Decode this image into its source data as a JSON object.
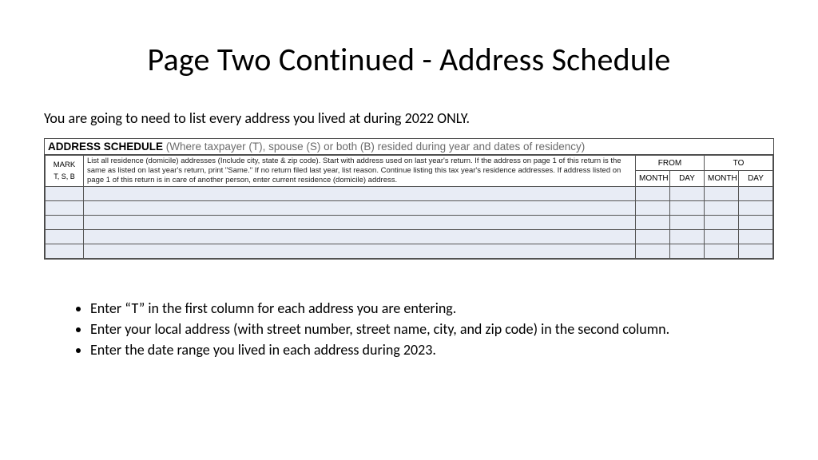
{
  "title": "Page Two Continued - Address Schedule",
  "intro": "You are going to need to list every address you lived at during 2022 ONLY.",
  "schedule": {
    "heading_strong": "ADDRESS SCHEDULE",
    "heading_paren": "(Where taxpayer (T), spouse (S) or both (B) resided during year and dates of residency)",
    "col_mark_top": "MARK",
    "col_mark_bot": "T, S, B",
    "col_desc": "List all residence (domicile) addresses (Include city, state & zip code). Start with address used on last year's return. If the address on page 1 of this return is the same as listed on last year's return, print \"Same.\" If no return filed last year, list reason. Continue listing this tax year's residence addresses. If address listed on page 1 of this return is in care of another person, enter current residence (domicile) address.",
    "col_from": "FROM",
    "col_to": "TO",
    "col_month": "MONTH",
    "col_day": "DAY"
  },
  "bullets": [
    "Enter “T” in the first column for each address you are entering.",
    "Enter your local address (with street number, street name, city, and zip code) in the second column.",
    "Enter the date range you lived in each address during 2023."
  ]
}
